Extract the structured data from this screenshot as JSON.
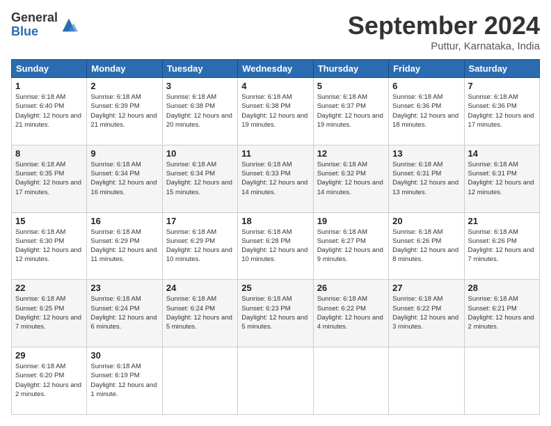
{
  "logo": {
    "general": "General",
    "blue": "Blue"
  },
  "header": {
    "month": "September 2024",
    "location": "Puttur, Karnataka, India"
  },
  "days_of_week": [
    "Sunday",
    "Monday",
    "Tuesday",
    "Wednesday",
    "Thursday",
    "Friday",
    "Saturday"
  ],
  "weeks": [
    [
      {
        "day": "1",
        "sunrise": "6:18 AM",
        "sunset": "6:40 PM",
        "daylight": "12 hours and 21 minutes."
      },
      {
        "day": "2",
        "sunrise": "6:18 AM",
        "sunset": "6:39 PM",
        "daylight": "12 hours and 21 minutes."
      },
      {
        "day": "3",
        "sunrise": "6:18 AM",
        "sunset": "6:38 PM",
        "daylight": "12 hours and 20 minutes."
      },
      {
        "day": "4",
        "sunrise": "6:18 AM",
        "sunset": "6:38 PM",
        "daylight": "12 hours and 19 minutes."
      },
      {
        "day": "5",
        "sunrise": "6:18 AM",
        "sunset": "6:37 PM",
        "daylight": "12 hours and 19 minutes."
      },
      {
        "day": "6",
        "sunrise": "6:18 AM",
        "sunset": "6:36 PM",
        "daylight": "12 hours and 18 minutes."
      },
      {
        "day": "7",
        "sunrise": "6:18 AM",
        "sunset": "6:36 PM",
        "daylight": "12 hours and 17 minutes."
      }
    ],
    [
      {
        "day": "8",
        "sunrise": "6:18 AM",
        "sunset": "6:35 PM",
        "daylight": "12 hours and 17 minutes."
      },
      {
        "day": "9",
        "sunrise": "6:18 AM",
        "sunset": "6:34 PM",
        "daylight": "12 hours and 16 minutes."
      },
      {
        "day": "10",
        "sunrise": "6:18 AM",
        "sunset": "6:34 PM",
        "daylight": "12 hours and 15 minutes."
      },
      {
        "day": "11",
        "sunrise": "6:18 AM",
        "sunset": "6:33 PM",
        "daylight": "12 hours and 14 minutes."
      },
      {
        "day": "12",
        "sunrise": "6:18 AM",
        "sunset": "6:32 PM",
        "daylight": "12 hours and 14 minutes."
      },
      {
        "day": "13",
        "sunrise": "6:18 AM",
        "sunset": "6:31 PM",
        "daylight": "12 hours and 13 minutes."
      },
      {
        "day": "14",
        "sunrise": "6:18 AM",
        "sunset": "6:31 PM",
        "daylight": "12 hours and 12 minutes."
      }
    ],
    [
      {
        "day": "15",
        "sunrise": "6:18 AM",
        "sunset": "6:30 PM",
        "daylight": "12 hours and 12 minutes."
      },
      {
        "day": "16",
        "sunrise": "6:18 AM",
        "sunset": "6:29 PM",
        "daylight": "12 hours and 11 minutes."
      },
      {
        "day": "17",
        "sunrise": "6:18 AM",
        "sunset": "6:29 PM",
        "daylight": "12 hours and 10 minutes."
      },
      {
        "day": "18",
        "sunrise": "6:18 AM",
        "sunset": "6:28 PM",
        "daylight": "12 hours and 10 minutes."
      },
      {
        "day": "19",
        "sunrise": "6:18 AM",
        "sunset": "6:27 PM",
        "daylight": "12 hours and 9 minutes."
      },
      {
        "day": "20",
        "sunrise": "6:18 AM",
        "sunset": "6:26 PM",
        "daylight": "12 hours and 8 minutes."
      },
      {
        "day": "21",
        "sunrise": "6:18 AM",
        "sunset": "6:26 PM",
        "daylight": "12 hours and 7 minutes."
      }
    ],
    [
      {
        "day": "22",
        "sunrise": "6:18 AM",
        "sunset": "6:25 PM",
        "daylight": "12 hours and 7 minutes."
      },
      {
        "day": "23",
        "sunrise": "6:18 AM",
        "sunset": "6:24 PM",
        "daylight": "12 hours and 6 minutes."
      },
      {
        "day": "24",
        "sunrise": "6:18 AM",
        "sunset": "6:24 PM",
        "daylight": "12 hours and 5 minutes."
      },
      {
        "day": "25",
        "sunrise": "6:18 AM",
        "sunset": "6:23 PM",
        "daylight": "12 hours and 5 minutes."
      },
      {
        "day": "26",
        "sunrise": "6:18 AM",
        "sunset": "6:22 PM",
        "daylight": "12 hours and 4 minutes."
      },
      {
        "day": "27",
        "sunrise": "6:18 AM",
        "sunset": "6:22 PM",
        "daylight": "12 hours and 3 minutes."
      },
      {
        "day": "28",
        "sunrise": "6:18 AM",
        "sunset": "6:21 PM",
        "daylight": "12 hours and 2 minutes."
      }
    ],
    [
      {
        "day": "29",
        "sunrise": "6:18 AM",
        "sunset": "6:20 PM",
        "daylight": "12 hours and 2 minutes."
      },
      {
        "day": "30",
        "sunrise": "6:18 AM",
        "sunset": "6:19 PM",
        "daylight": "12 hours and 1 minute."
      },
      null,
      null,
      null,
      null,
      null
    ]
  ]
}
